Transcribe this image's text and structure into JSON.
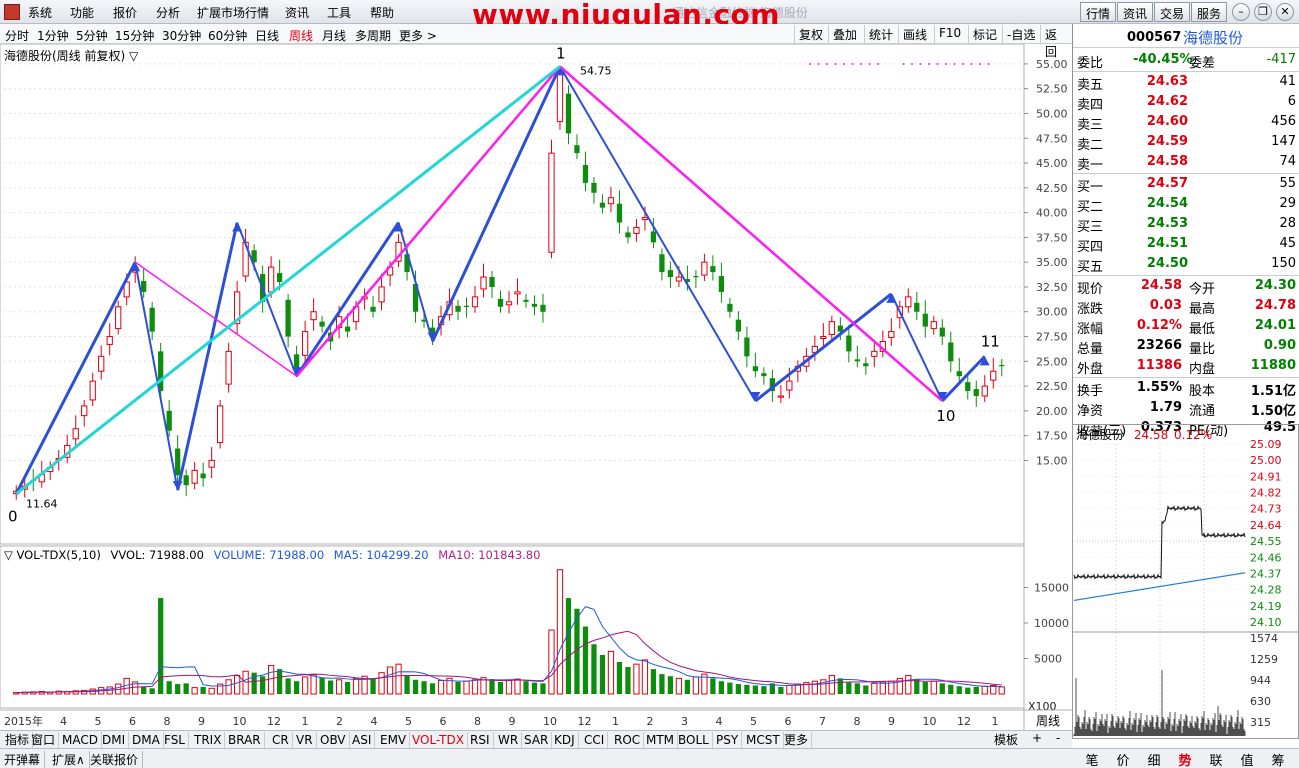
{
  "menu": {
    "items": [
      "系统",
      "功能",
      "报价",
      "分析",
      "扩展市场行情",
      "资讯",
      "工具",
      "帮助"
    ],
    "banner": "www.niugulan.com",
    "subtitle": "通达信金融终端  海德股份",
    "right_buttons": [
      "行情",
      "资讯",
      "交易",
      "服务"
    ]
  },
  "periods": {
    "items": [
      "分时",
      "1分钟",
      "5分钟",
      "15分钟",
      "30分钟",
      "60分钟",
      "日线",
      "周线",
      "月线",
      "多周期",
      "更多 >"
    ],
    "active": "周线"
  },
  "tools": [
    "复权",
    "叠加",
    "统计",
    "画线",
    "F10",
    "标记",
    "-自选",
    "返回"
  ],
  "chart_title": "海德股份(周线 前复权) ▽",
  "chart_data": [
    {
      "type": "candlestick",
      "title": "海德股份(周线 前复权)",
      "ylim": [
        10,
        56
      ],
      "yticks": [
        15,
        17.5,
        20,
        22.5,
        25,
        27.5,
        30,
        32.5,
        35,
        37.5,
        40,
        42.5,
        45,
        47.5,
        50,
        52.5,
        55
      ],
      "xtick_labels": [
        "2015年",
        "4",
        "5",
        "6",
        "8",
        "9",
        "10",
        "12",
        "1",
        "2",
        "4",
        "5",
        "6",
        "8",
        "9",
        "10",
        "12",
        "1",
        "2",
        "3",
        "4",
        "5",
        "6",
        "7",
        "8",
        "9",
        "10",
        "12",
        "1"
      ],
      "annotations": {
        "low": "11.64",
        "high": "54.75"
      },
      "wave_labels": [
        "0",
        "1",
        "10",
        "11"
      ],
      "close": [
        11.9,
        12.4,
        13.0,
        13.6,
        14.3,
        15.2,
        16.5,
        18.2,
        20.5,
        23.0,
        25.5,
        27.5,
        30.5,
        33.0,
        34.5,
        32.0,
        28.0,
        22.0,
        18.0,
        13.5,
        12.5,
        14.0,
        13.2,
        15.0,
        20.5,
        26.0,
        32.0,
        37.0,
        35.0,
        31.0,
        34.5,
        33.0,
        27.5,
        24.0,
        28.0,
        30.0,
        28.5,
        27.0,
        29.5,
        28.0,
        30.5,
        31.5,
        30.0,
        32.5,
        34.5,
        37.0,
        34.0,
        30.0,
        29.0,
        27.5,
        29.5,
        31.0,
        30.0,
        30.5,
        31.5,
        33.5,
        32.5,
        30.5,
        31.0,
        32.0,
        31.0,
        30.5,
        30.0,
        46.0,
        54.0,
        48.0,
        46.0,
        43.0,
        42.0,
        40.5,
        41.5,
        39.0,
        37.5,
        38.5,
        39.5,
        37.0,
        34.0,
        33.5,
        33.5,
        33.0,
        33.5,
        35.0,
        34.0,
        32.0,
        30.0,
        28.0,
        25.5,
        24.0,
        23.5,
        22.0,
        21.5,
        23.0,
        24.5,
        25.5,
        26.5,
        27.5,
        29.0,
        28.0,
        26.0,
        25.0,
        24.5,
        26.0,
        27.0,
        28.0,
        30.5,
        31.5,
        30.0,
        28.5,
        29.0,
        27.5,
        25.0,
        23.5,
        22.0,
        21.5,
        22.5,
        24.0,
        24.58
      ],
      "volume_panel": {
        "header": {
          "name": "▽ VOL-TDX(5,10)",
          "vvol": "VVOL: 71988.00",
          "volume": "VOLUME: 71988.00",
          "ma5": "MA5: 104299.20",
          "ma10": "MA10: 101843.80"
        },
        "yticks": [
          5000,
          10000,
          15000
        ],
        "scale_label": "X100",
        "period_label": "周线",
        "volume": [
          200,
          250,
          300,
          350,
          250,
          400,
          350,
          450,
          500,
          700,
          900,
          1000,
          1400,
          2200,
          1700,
          1000,
          800,
          13500,
          1800,
          1400,
          1500,
          900,
          1000,
          800,
          1400,
          2000,
          2600,
          3200,
          3000,
          2500,
          4000,
          3500,
          2200,
          1800,
          2400,
          2700,
          2300,
          1900,
          2000,
          1700,
          2200,
          2500,
          2100,
          3000,
          3800,
          4200,
          2600,
          2000,
          1800,
          1500,
          1900,
          2200,
          1700,
          1800,
          2000,
          2300,
          2100,
          1700,
          1900,
          2100,
          1800,
          1600,
          1500,
          9000,
          17500,
          13500,
          12000,
          9500,
          7000,
          5500,
          6000,
          4500,
          3800,
          4200,
          4800,
          3500,
          2800,
          2500,
          2200,
          2000,
          2400,
          2800,
          2200,
          1800,
          1600,
          1400,
          1300,
          1200,
          1100,
          1500,
          1000,
          1200,
          1400,
          1600,
          1800,
          2000,
          2600,
          2200,
          1600,
          1500,
          1200,
          1500,
          1700,
          1800,
          2200,
          2600,
          2100,
          1700,
          1800,
          1500,
          1300,
          1100,
          900,
          1000,
          1100,
          1200,
          1000
        ]
      }
    }
  ],
  "quote": {
    "code": "000567",
    "name": "海德股份",
    "weibi": {
      "label": "委比",
      "value": "-40.45%",
      "diff_label": "委差",
      "diff": "-417"
    },
    "sell": [
      {
        "label": "卖五",
        "price": "24.63",
        "vol": "41"
      },
      {
        "label": "卖四",
        "price": "24.62",
        "vol": "6"
      },
      {
        "label": "卖三",
        "price": "24.60",
        "vol": "456"
      },
      {
        "label": "卖二",
        "price": "24.59",
        "vol": "147"
      },
      {
        "label": "卖一",
        "price": "24.58",
        "vol": "74"
      }
    ],
    "buy": [
      {
        "label": "买一",
        "price": "24.57",
        "vol": "55"
      },
      {
        "label": "买二",
        "price": "24.54",
        "vol": "29"
      },
      {
        "label": "买三",
        "price": "24.53",
        "vol": "28"
      },
      {
        "label": "买四",
        "price": "24.51",
        "vol": "45"
      },
      {
        "label": "买五",
        "price": "24.50",
        "vol": "150"
      }
    ],
    "stats": [
      {
        "l1": "现价",
        "v1": "24.58",
        "c1": "red",
        "l2": "今开",
        "v2": "24.30",
        "c2": "green"
      },
      {
        "l1": "涨跌",
        "v1": "0.03",
        "c1": "red",
        "l2": "最高",
        "v2": "24.78",
        "c2": "red"
      },
      {
        "l1": "涨幅",
        "v1": "0.12%",
        "c1": "red",
        "l2": "最低",
        "v2": "24.01",
        "c2": "green"
      },
      {
        "l1": "总量",
        "v1": "23266",
        "c1": "black",
        "l2": "量比",
        "v2": "0.90",
        "c2": "green"
      },
      {
        "l1": "外盘",
        "v1": "11386",
        "c1": "red",
        "l2": "内盘",
        "v2": "11880",
        "c2": "green"
      }
    ],
    "stats2": [
      {
        "l1": "换手",
        "v1": "1.55%",
        "l2": "股本",
        "v2": "1.51亿"
      },
      {
        "l1": "净资",
        "v1": "1.79",
        "l2": "流通",
        "v2": "1.50亿"
      },
      {
        "l1": "收益(三)",
        "v1": "0.373",
        "l2": "PE(动)",
        "v2": "49.5"
      }
    ]
  },
  "intraday": {
    "title_name": "海德股份",
    "title_price": "24.58",
    "title_pct": "0.12%",
    "price_ticks": [
      "25.09",
      "25.00",
      "24.91",
      "24.82",
      "24.73",
      "24.64",
      "24.55",
      "24.46",
      "24.37",
      "24.28",
      "24.19",
      "24.10"
    ],
    "vol_ticks": [
      "1574",
      "1259",
      "944",
      "630",
      "315"
    ]
  },
  "indicator_tabs": {
    "items": [
      "指标",
      "窗口",
      "MACD",
      "DMI",
      "DMA",
      "FSL",
      "TRIX",
      "BRAR",
      "CR",
      "VR",
      "OBV",
      "ASI",
      "EMV",
      "VOL-TDX",
      "RSI",
      "WR",
      "SAR",
      "KDJ",
      "CCI",
      "ROC",
      "MTM",
      "BOLL",
      "PSY",
      "MCST",
      "更多"
    ],
    "active": "VOL-TDX",
    "template": "模板",
    "plus": "+",
    "minus": "-"
  },
  "status_bar": [
    "开弹幕",
    "扩展∧",
    "关联报价"
  ],
  "right_tabs": {
    "items": [
      "笔",
      "价",
      "细",
      "势",
      "联",
      "值",
      "筹"
    ],
    "active": "势"
  },
  "colors": {
    "up": "#e0000f",
    "down": "#0e8c0e",
    "wave_blue": "#2d4fd8",
    "wave_magenta": "#ff1cf0",
    "wave_cyan": "#21d6d6"
  }
}
